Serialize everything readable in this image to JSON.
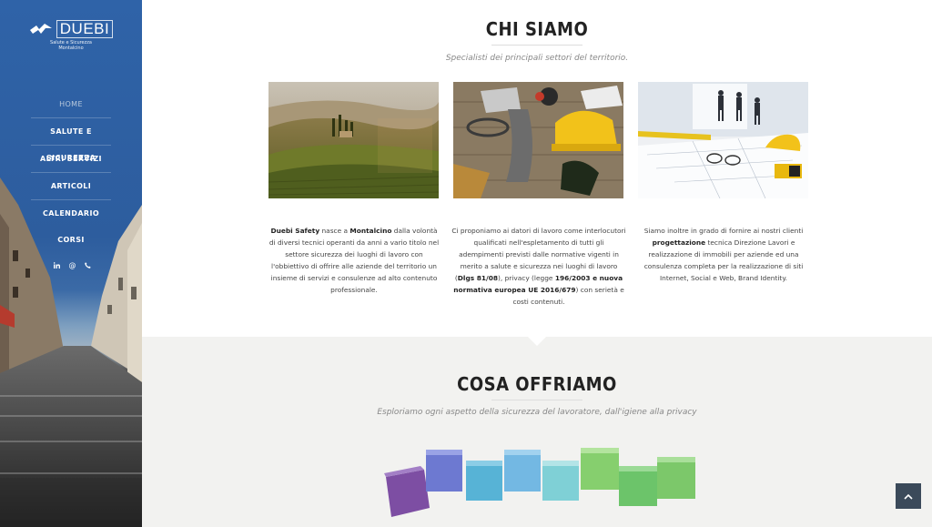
{
  "brand": {
    "name": "DUEBI",
    "tagline_1": "Salute e Sicurezza",
    "tagline_2": "Montalcino"
  },
  "nav": {
    "items": [
      {
        "label": "HOME",
        "active": true
      },
      {
        "label": "SALUTE E SICUREZZA",
        "active": false
      },
      {
        "label": "ALTRI SERVIZI",
        "active": false
      },
      {
        "label": "ARTICOLI",
        "active": false
      },
      {
        "label": "CALENDARIO CORSI",
        "active": false
      }
    ]
  },
  "social": [
    "linkedin-icon",
    "at-icon",
    "phone-icon"
  ],
  "chi_siamo": {
    "title": "CHI SIAMO",
    "subtitle": "Specialisti dei principali settori del territorio.",
    "columns": [
      {
        "image": "tuscany-landscape",
        "parts": [
          {
            "t": "Duebi Safety",
            "b": true
          },
          {
            "t": " nasce a ",
            "b": false
          },
          {
            "t": "Montalcino",
            "b": true
          },
          {
            "t": " dalla volontà di diversi tecnici operanti da anni a vario titolo nel settore sicurezza dei luoghi di lavoro con l'obbiettivo di offrire alle aziende del territorio un insieme di servizi e consulenze ad alto contenuto professionale.",
            "b": false
          }
        ]
      },
      {
        "image": "safety-equipment",
        "parts": [
          {
            "t": "Ci proponiamo ai datori di lavoro come interlocutori qualificati nell'espletamento di tutti gli adempimenti previsti dalle normative vigenti in merito a salute e sicurezza nei luoghi di lavoro (",
            "b": false
          },
          {
            "t": "Dlgs 81/08",
            "b": true
          },
          {
            "t": "), privacy (legge ",
            "b": false
          },
          {
            "t": "196/2003",
            "b": true
          },
          {
            "t": " e nuova normativa europea ",
            "b": true
          },
          {
            "t": "UE 2016/679",
            "b": true
          },
          {
            "t": ") con serietà e costi contenuti.",
            "b": false
          }
        ]
      },
      {
        "image": "design-office",
        "parts": [
          {
            "t": "Siamo inoltre in grado di fornire ai nostri clienti ",
            "b": false
          },
          {
            "t": "progettazione",
            "b": true
          },
          {
            "t": " tecnica Direzione Lavori e realizzazione di immobili per aziende ed una consulenza completa per la realizzazione di siti Internet, Social e Web, Brand Identity.",
            "b": false
          }
        ]
      }
    ]
  },
  "cosa_offriamo": {
    "title": "COSA OFFRIAMO",
    "subtitle": "Esploriamo ogni aspetto della sicurezza del lavoratore, dall'igiene alla privacy"
  },
  "scroll_top": {
    "icon": "chevron-up-icon"
  }
}
